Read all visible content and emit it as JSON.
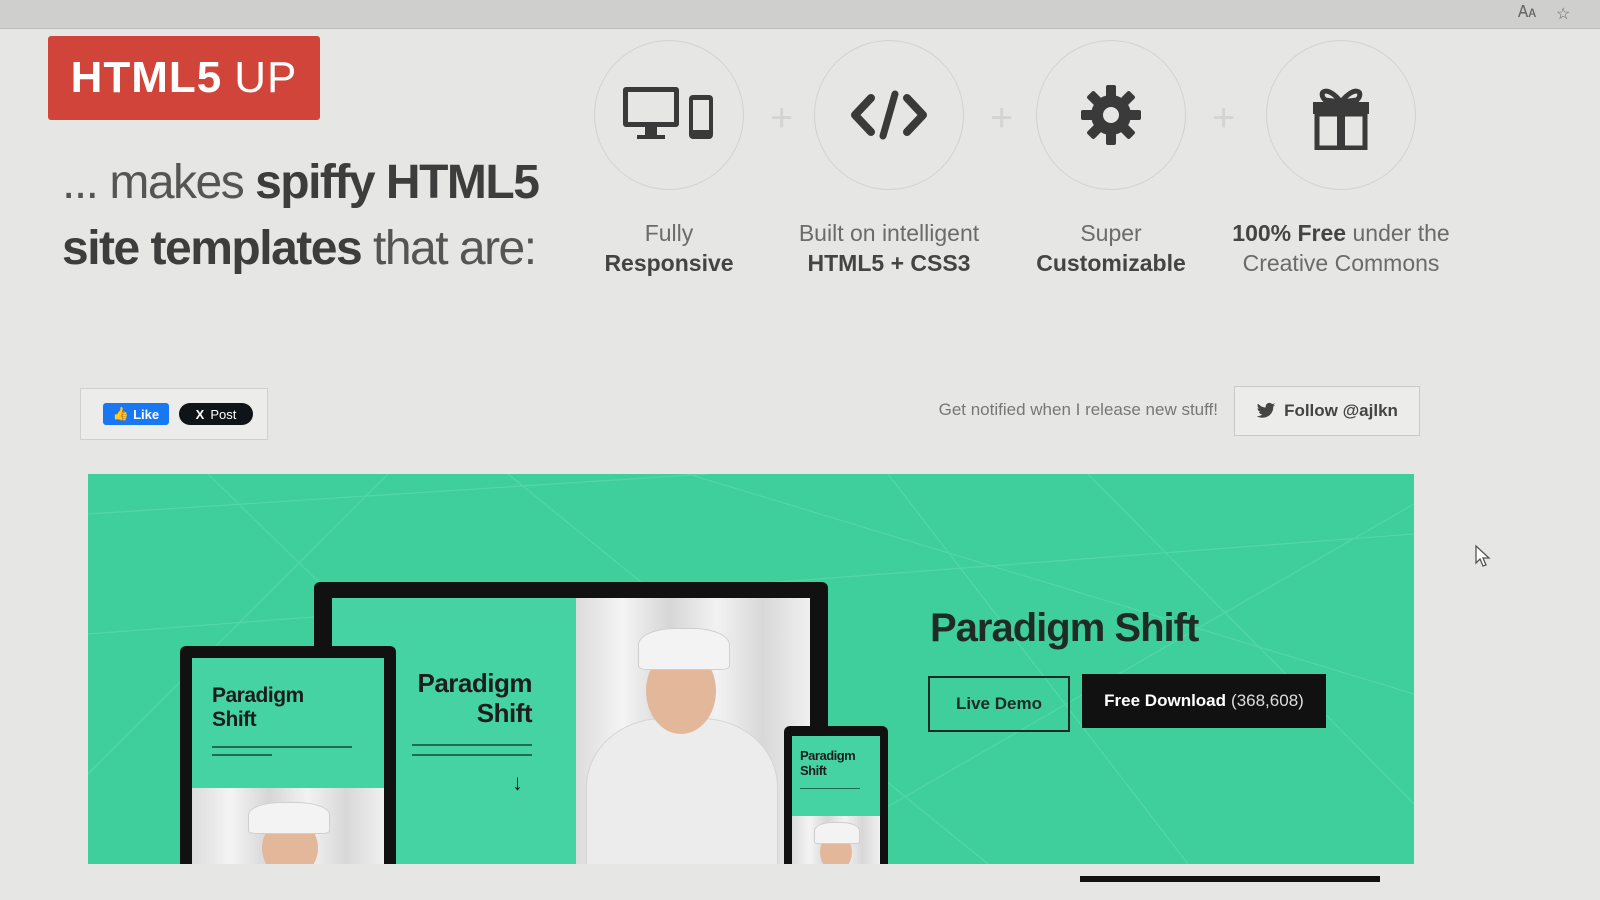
{
  "logo": {
    "bold": "HTML5",
    "light": "UP"
  },
  "tagline": {
    "prefix": "... makes ",
    "bold1": "spiffy HTML5",
    "bold2": "site templates",
    "suffix": " that are:"
  },
  "features": [
    {
      "icon": "devices-icon",
      "line1": "Fully",
      "line2": "Responsive",
      "bold_line": 2
    },
    {
      "icon": "code-icon",
      "line1": "Built on intelligent",
      "line2": "HTML5 + CSS3",
      "bold_line": 2
    },
    {
      "icon": "gear-icon",
      "line1": "Super",
      "line2": "Customizable",
      "bold_line": 2
    },
    {
      "icon": "gift-icon",
      "line1_bold": "100% Free",
      "line1_rest": " under the",
      "line2": "Creative Commons"
    }
  ],
  "social": {
    "like_label": "Like",
    "post_label": "Post",
    "notify_text": "Get notified when I release new stuff!",
    "follow_label": "Follow @ajlkn"
  },
  "featured": {
    "title": "Paradigm Shift",
    "live_demo_label": "Live Demo",
    "download_label": "Free Download",
    "download_count": "(368,608)",
    "accent_color": "#3ecf9c",
    "screen_title_line1": "Paradigm",
    "screen_title_line2": "Shift"
  }
}
